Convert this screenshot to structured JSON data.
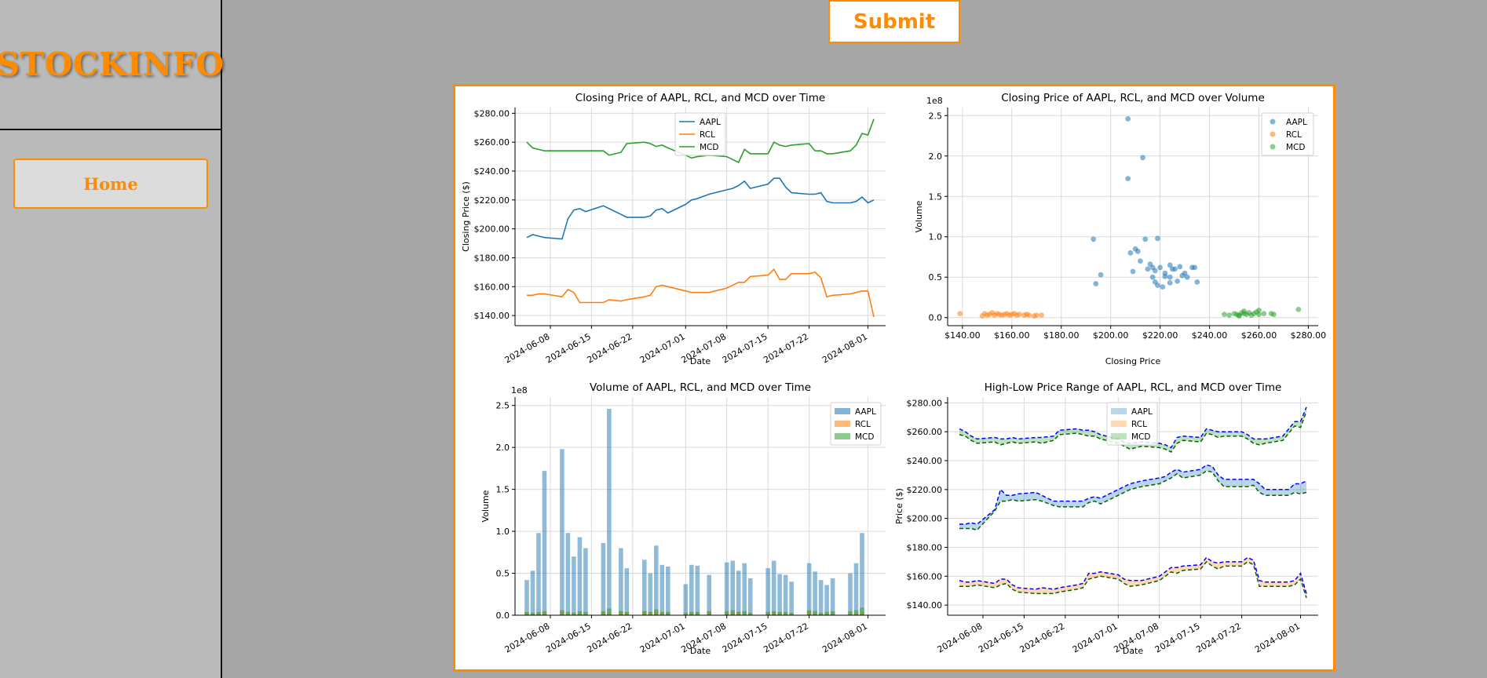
{
  "app": {
    "logo": "STOCKINFO"
  },
  "sidebar": {
    "home_label": "Home"
  },
  "toolbar": {
    "submit_label": "Submit"
  },
  "colors": {
    "accent": "#ff8c00",
    "AAPL": "#1f77b4",
    "RCL": "#ff7f0e",
    "MCD": "#2ca02c"
  },
  "chart_data": [
    {
      "type": "line",
      "title": "Closing Price of AAPL, RCL, and MCD over Time",
      "xlabel": "Date",
      "ylabel": "Closing Price ($)",
      "xticks": [
        "2024-06-08",
        "2024-06-15",
        "2024-06-22",
        "2024-07-01",
        "2024-07-08",
        "2024-07-15",
        "2024-07-22",
        "2024-08-01"
      ],
      "yticks": [
        "$140.00",
        "$160.00",
        "$180.00",
        "$200.00",
        "$220.00",
        "$240.00",
        "$260.00",
        "$280.00"
      ],
      "ylim": [
        133,
        284
      ],
      "legend": "top-center",
      "grid": true,
      "x": [
        "2024-06-04",
        "2024-06-05",
        "2024-06-06",
        "2024-06-07",
        "2024-06-10",
        "2024-06-11",
        "2024-06-12",
        "2024-06-13",
        "2024-06-14",
        "2024-06-17",
        "2024-06-18",
        "2024-06-20",
        "2024-06-21",
        "2024-06-24",
        "2024-06-25",
        "2024-06-26",
        "2024-06-27",
        "2024-06-28",
        "2024-07-01",
        "2024-07-02",
        "2024-07-03",
        "2024-07-05",
        "2024-07-08",
        "2024-07-09",
        "2024-07-10",
        "2024-07-11",
        "2024-07-12",
        "2024-07-15",
        "2024-07-16",
        "2024-07-17",
        "2024-07-18",
        "2024-07-19",
        "2024-07-22",
        "2024-07-23",
        "2024-07-24",
        "2024-07-25",
        "2024-07-26",
        "2024-07-29",
        "2024-07-30",
        "2024-07-31",
        "2024-08-01",
        "2024-08-02"
      ],
      "series": [
        {
          "name": "AAPL",
          "values": [
            194,
            196,
            195,
            194,
            193,
            207,
            213,
            214,
            212,
            216,
            214,
            210,
            208,
            208,
            209,
            213,
            214,
            211,
            217,
            220,
            221,
            224,
            227,
            228,
            230,
            233,
            228,
            231,
            235,
            235,
            229,
            225,
            224,
            224,
            225,
            219,
            218,
            218,
            219,
            222,
            218,
            220
          ]
        },
        {
          "name": "RCL",
          "values": [
            154,
            154,
            155,
            155,
            153,
            158,
            156,
            149,
            149,
            149,
            151,
            150,
            151,
            153,
            154,
            160,
            161,
            160,
            157,
            156,
            156,
            156,
            159,
            161,
            163,
            163,
            167,
            168,
            172,
            165,
            165,
            169,
            169,
            170,
            166,
            153,
            154,
            155,
            156,
            157,
            157,
            139
          ]
        },
        {
          "name": "MCD",
          "values": [
            260,
            256,
            255,
            254,
            254,
            254,
            254,
            254,
            254,
            254,
            251,
            253,
            259,
            260,
            259,
            257,
            258,
            256,
            251,
            249,
            250,
            251,
            250,
            248,
            246,
            255,
            252,
            252,
            260,
            258,
            257,
            258,
            259,
            254,
            254,
            252,
            252,
            254,
            258,
            266,
            265,
            276
          ]
        }
      ]
    },
    {
      "type": "scatter",
      "title": "Closing Price of AAPL, RCL, and MCD over Volume",
      "xlabel": "Closing Price",
      "ylabel": "Volume",
      "y_offset_label": "1e8",
      "xticks": [
        "$140.00",
        "$160.00",
        "$180.00",
        "$200.00",
        "$220.00",
        "$240.00",
        "$260.00",
        "$280.00"
      ],
      "yticks": [
        "0.0",
        "0.5",
        "1.0",
        "1.5",
        "2.0",
        "2.5"
      ],
      "xlim": [
        134,
        284
      ],
      "ylim": [
        -0.1,
        2.6
      ],
      "legend": "top-right",
      "grid": true,
      "series": [
        {
          "name": "AAPL",
          "points": [
            [
              207,
              2.46
            ],
            [
              213,
              1.98
            ],
            [
              207,
              1.72
            ],
            [
              193,
              0.97
            ],
            [
              196,
              0.53
            ],
            [
              194,
              0.42
            ],
            [
              208,
              0.8
            ],
            [
              210,
              0.85
            ],
            [
              211,
              0.82
            ],
            [
              214,
              0.97
            ],
            [
              219,
              0.98
            ],
            [
              212,
              0.7
            ],
            [
              215,
              0.6
            ],
            [
              216,
              0.66
            ],
            [
              217,
              0.62
            ],
            [
              218,
              0.58
            ],
            [
              220,
              0.62
            ],
            [
              222,
              0.55
            ],
            [
              224,
              0.65
            ],
            [
              226,
              0.6
            ],
            [
              228,
              0.63
            ],
            [
              230,
              0.55
            ],
            [
              233,
              0.62
            ],
            [
              235,
              0.44
            ],
            [
              218,
              0.44
            ],
            [
              221,
              0.38
            ],
            [
              224,
              0.5
            ],
            [
              227,
              0.45
            ],
            [
              229,
              0.52
            ],
            [
              231,
              0.5
            ],
            [
              225,
              0.6
            ],
            [
              209,
              0.57
            ],
            [
              217,
              0.5
            ],
            [
              219,
              0.4
            ],
            [
              224,
              0.43
            ],
            [
              222,
              0.51
            ],
            [
              234,
              0.62
            ]
          ]
        },
        {
          "name": "RCL",
          "points": [
            [
              139,
              0.05
            ],
            [
              149,
              0.05
            ],
            [
              150,
              0.03
            ],
            [
              151,
              0.04
            ],
            [
              152,
              0.06
            ],
            [
              153,
              0.03
            ],
            [
              154,
              0.05
            ],
            [
              155,
              0.04
            ],
            [
              156,
              0.03
            ],
            [
              157,
              0.04
            ],
            [
              158,
              0.05
            ],
            [
              159,
              0.03
            ],
            [
              160,
              0.04
            ],
            [
              161,
              0.05
            ],
            [
              162,
              0.03
            ],
            [
              163,
              0.04
            ],
            [
              165,
              0.03
            ],
            [
              166,
              0.04
            ],
            [
              167,
              0.03
            ],
            [
              169,
              0.02
            ],
            [
              170,
              0.03
            ],
            [
              172,
              0.03
            ],
            [
              148,
              0.02
            ]
          ]
        },
        {
          "name": "MCD",
          "points": [
            [
              246,
              0.04
            ],
            [
              248,
              0.03
            ],
            [
              250,
              0.05
            ],
            [
              251,
              0.04
            ],
            [
              252,
              0.03
            ],
            [
              253,
              0.06
            ],
            [
              254,
              0.05
            ],
            [
              254,
              0.08
            ],
            [
              255,
              0.04
            ],
            [
              256,
              0.06
            ],
            [
              257,
              0.03
            ],
            [
              258,
              0.05
            ],
            [
              259,
              0.07
            ],
            [
              260,
              0.04
            ],
            [
              260,
              0.09
            ],
            [
              252,
              0.02
            ],
            [
              265,
              0.05
            ],
            [
              266,
              0.04
            ],
            [
              276,
              0.1
            ],
            [
              262,
              0.05
            ]
          ]
        }
      ]
    },
    {
      "type": "bar",
      "title": "Volume of AAPL, RCL, and MCD over Time",
      "xlabel": "Date",
      "ylabel": "Volume",
      "y_offset_label": "1e8",
      "xticks": [
        "2024-06-08",
        "2024-06-15",
        "2024-06-22",
        "2024-07-01",
        "2024-07-08",
        "2024-07-15",
        "2024-07-22",
        "2024-08-01"
      ],
      "yticks": [
        "0.0",
        "0.5",
        "1.0",
        "1.5",
        "2.0",
        "2.5"
      ],
      "ylim": [
        0,
        2.6
      ],
      "legend": "top-right",
      "grid": true,
      "series": [
        {
          "name": "AAPL",
          "values": [
            0.42,
            0.53,
            0.98,
            1.72,
            1.98,
            0.98,
            0.7,
            0.93,
            0.8,
            0.86,
            2.46,
            0.8,
            0.56,
            0.66,
            0.5,
            0.83,
            0.6,
            0.58,
            0.37,
            0.6,
            0.59,
            0.48,
            0.63,
            0.65,
            0.53,
            0.62,
            0.44,
            0.56,
            0.65,
            0.49,
            0.48,
            0.4,
            0.62,
            0.52,
            0.42,
            0.36,
            0.44,
            0.5,
            0.62,
            0.98
          ]
        },
        {
          "name": "RCL",
          "values": [
            0.03,
            0.02,
            0.03,
            0.04,
            0.05,
            0.03,
            0.03,
            0.03,
            0.02,
            0.04,
            0.03,
            0.04,
            0.04,
            0.05,
            0.04,
            0.05,
            0.03,
            0.03,
            0.02,
            0.03,
            0.03,
            0.04,
            0.03,
            0.04,
            0.04,
            0.03,
            0.02,
            0.03,
            0.04,
            0.03,
            0.03,
            0.02,
            0.05,
            0.03,
            0.02,
            0.02,
            0.03,
            0.03,
            0.03,
            0.04
          ]
        },
        {
          "name": "MCD",
          "values": [
            0.04,
            0.03,
            0.04,
            0.05,
            0.06,
            0.04,
            0.03,
            0.05,
            0.04,
            0.05,
            0.08,
            0.05,
            0.04,
            0.05,
            0.04,
            0.07,
            0.04,
            0.04,
            0.03,
            0.04,
            0.04,
            0.05,
            0.05,
            0.06,
            0.04,
            0.05,
            0.03,
            0.04,
            0.05,
            0.04,
            0.04,
            0.03,
            0.06,
            0.05,
            0.03,
            0.04,
            0.05,
            0.05,
            0.06,
            0.09
          ]
        }
      ]
    },
    {
      "type": "area",
      "title": "High-Low Price Range of AAPL, RCL, and MCD over Time",
      "xlabel": "Date",
      "ylabel": "Price ($)",
      "xticks": [
        "2024-06-08",
        "2024-06-15",
        "2024-06-22",
        "2024-07-01",
        "2024-07-08",
        "2024-07-15",
        "2024-07-22",
        "2024-08-01"
      ],
      "yticks": [
        "$140.00",
        "$160.00",
        "$180.00",
        "$200.00",
        "$220.00",
        "$240.00",
        "$260.00",
        "$280.00"
      ],
      "ylim": [
        133,
        284
      ],
      "legend": "top-center",
      "grid": true,
      "series": [
        {
          "name": "AAPL",
          "high": [
            196,
            196,
            197,
            196,
            206,
            220,
            216,
            216,
            217,
            218,
            216,
            212,
            212,
            212,
            212,
            214,
            215,
            214,
            220,
            222,
            224,
            226,
            228,
            229,
            232,
            234,
            232,
            234,
            237,
            236,
            230,
            227,
            227,
            227,
            227,
            224,
            220,
            220,
            220,
            224,
            224,
            226
          ],
          "low": [
            193,
            193,
            193,
            192,
            205,
            212,
            212,
            213,
            212,
            213,
            212,
            209,
            208,
            208,
            208,
            211,
            212,
            210,
            216,
            218,
            220,
            222,
            224,
            226,
            228,
            231,
            228,
            230,
            233,
            232,
            226,
            222,
            222,
            222,
            223,
            218,
            216,
            216,
            216,
            218,
            217,
            218
          ]
        },
        {
          "name": "RCL",
          "high": [
            157,
            156,
            156,
            157,
            155,
            158,
            158,
            154,
            152,
            151,
            152,
            151,
            152,
            154,
            155,
            162,
            162,
            163,
            161,
            158,
            157,
            157,
            160,
            163,
            166,
            166,
            167,
            168,
            173,
            170,
            169,
            170,
            170,
            173,
            171,
            157,
            156,
            156,
            156,
            157,
            162,
            148
          ]
        },
        {
          "name": "MCD",
          "high": [
            262,
            260,
            257,
            255,
            256,
            255,
            255,
            256,
            255,
            256,
            256,
            257,
            261,
            262,
            261,
            261,
            260,
            258,
            255,
            253,
            252,
            253,
            252,
            251,
            249,
            256,
            257,
            256,
            262,
            261,
            260,
            260,
            260,
            258,
            255,
            255,
            255,
            257,
            262,
            267,
            267,
            277
          ]
        }
      ]
    }
  ]
}
